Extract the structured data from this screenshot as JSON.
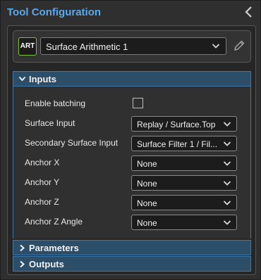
{
  "title": "Tool Configuration",
  "tool": {
    "badge": "ART",
    "selected": "Surface Arithmetic 1"
  },
  "sections": {
    "inputs": "Inputs",
    "parameters": "Parameters",
    "outputs": "Outputs"
  },
  "inputs": {
    "enable_batching": {
      "label": "Enable batching",
      "checked": false
    },
    "surface_input": {
      "label": "Surface Input",
      "value": "Replay / Surface.Top"
    },
    "secondary_surface_input": {
      "label": "Secondary Surface Input",
      "value": "Surface Filter 1 / Fil..."
    },
    "anchor_x": {
      "label": "Anchor X",
      "value": "None"
    },
    "anchor_y": {
      "label": "Anchor Y",
      "value": "None"
    },
    "anchor_z": {
      "label": "Anchor Z",
      "value": "None"
    },
    "anchor_z_angle": {
      "label": "Anchor Z Angle",
      "value": "None"
    }
  },
  "colors": {
    "title": "#5aa9ee",
    "section_header": "#2d4e68",
    "section_border": "#3f78a6",
    "badge_border": "#7fbf3f"
  },
  "icons": {
    "collapse": "chevron-left-icon",
    "dropdown": "chevron-down-icon",
    "edit": "pencil-icon",
    "expanded": "chevron-down-icon",
    "collapsed": "chevron-right-icon"
  }
}
